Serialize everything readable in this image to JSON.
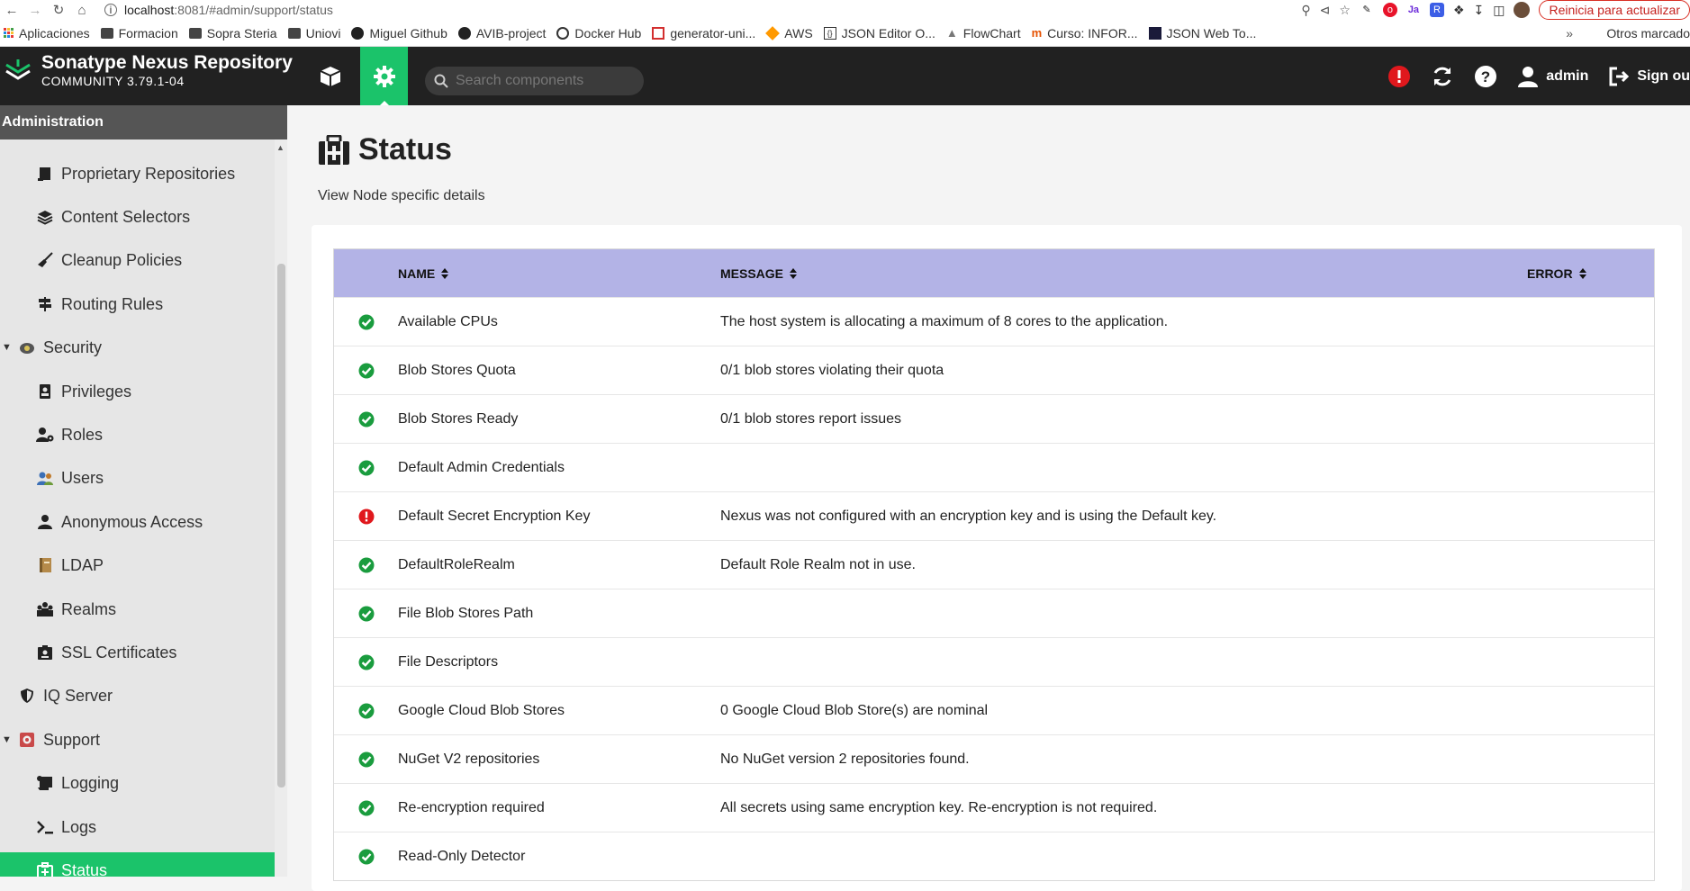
{
  "browser": {
    "url_host": "localhost",
    "url_path": ":8081/#admin/support/status",
    "update_label": "Reinicia para actualizar"
  },
  "bookmarks": {
    "items": [
      {
        "label": "Aplicaciones"
      },
      {
        "label": "Formacion"
      },
      {
        "label": "Sopra Steria"
      },
      {
        "label": "Uniovi"
      },
      {
        "label": "Miguel Github"
      },
      {
        "label": "AVIB-project"
      },
      {
        "label": "Docker Hub"
      },
      {
        "label": "generator-uni..."
      },
      {
        "label": "AWS"
      },
      {
        "label": "JSON Editor O..."
      },
      {
        "label": "FlowChart"
      },
      {
        "label": "Curso: INFOR..."
      },
      {
        "label": "JSON Web To..."
      }
    ],
    "more": "»",
    "other": "Otros marcado"
  },
  "header": {
    "title": "Sonatype Nexus Repository",
    "edition": "COMMUNITY 3.79.1-04",
    "search_placeholder": "Search components",
    "user": "admin",
    "sign_out": "Sign ou"
  },
  "sidebar": {
    "title": "Administration",
    "items": [
      {
        "label": "Proprietary Repositories"
      },
      {
        "label": "Content Selectors"
      },
      {
        "label": "Cleanup Policies"
      },
      {
        "label": "Routing Rules"
      },
      {
        "label": "Security"
      },
      {
        "label": "Privileges"
      },
      {
        "label": "Roles"
      },
      {
        "label": "Users"
      },
      {
        "label": "Anonymous Access"
      },
      {
        "label": "LDAP"
      },
      {
        "label": "Realms"
      },
      {
        "label": "SSL Certificates"
      },
      {
        "label": "IQ Server"
      },
      {
        "label": "Support"
      },
      {
        "label": "Logging"
      },
      {
        "label": "Logs"
      },
      {
        "label": "Status"
      }
    ]
  },
  "page": {
    "title": "Status",
    "description": "View Node specific details"
  },
  "table": {
    "headers": {
      "name": "NAME",
      "message": "MESSAGE",
      "error": "ERROR"
    },
    "rows": [
      {
        "status": "ok",
        "name": "Available CPUs",
        "message": "The host system is allocating a maximum of 8 cores to the application."
      },
      {
        "status": "ok",
        "name": "Blob Stores Quota",
        "message": "0/1 blob stores violating their quota"
      },
      {
        "status": "ok",
        "name": "Blob Stores Ready",
        "message": "0/1 blob stores report issues"
      },
      {
        "status": "ok",
        "name": "Default Admin Credentials",
        "message": ""
      },
      {
        "status": "error",
        "name": "Default Secret Encryption Key",
        "message": "Nexus was not configured with an encryption key and is using the Default key."
      },
      {
        "status": "ok",
        "name": "DefaultRoleRealm",
        "message": "Default Role Realm not in use."
      },
      {
        "status": "ok",
        "name": "File Blob Stores Path",
        "message": ""
      },
      {
        "status": "ok",
        "name": "File Descriptors",
        "message": ""
      },
      {
        "status": "ok",
        "name": "Google Cloud Blob Stores",
        "message": "0 Google Cloud Blob Store(s) are nominal"
      },
      {
        "status": "ok",
        "name": "NuGet V2 repositories",
        "message": "No NuGet version 2 repositories found."
      },
      {
        "status": "ok",
        "name": "Re-encryption required",
        "message": "All secrets using same encryption key. Re-encryption is not required."
      },
      {
        "status": "ok",
        "name": "Read-Only Detector",
        "message": ""
      }
    ]
  },
  "colors": {
    "accent": "#1bc36a",
    "header_bg": "#212121",
    "table_header_bg": "#b3b3e6",
    "ok": "#1a9c3e",
    "error": "#e0181d"
  }
}
